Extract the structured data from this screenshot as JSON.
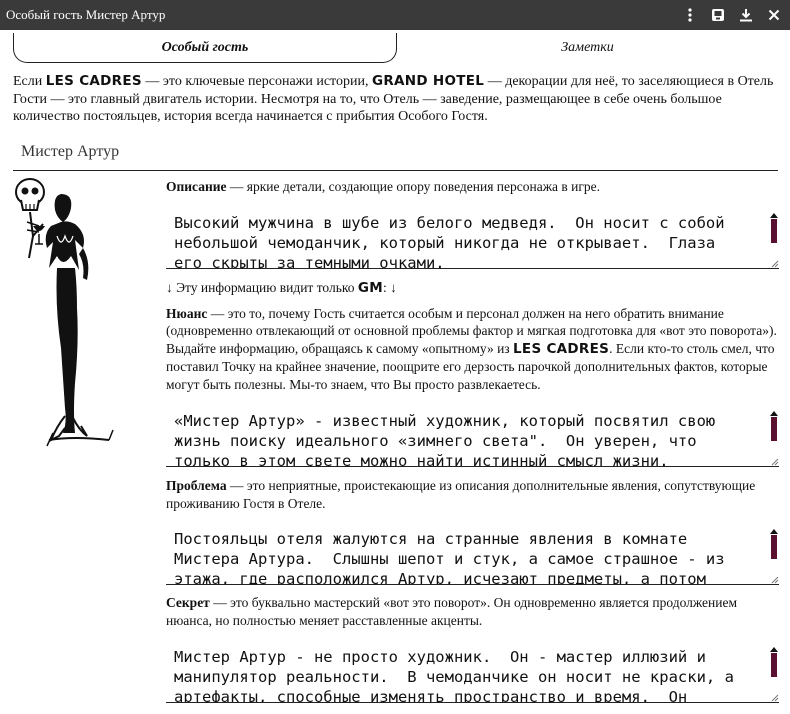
{
  "window": {
    "title": "Особый гость Мистер Артур",
    "menu_icon": "more-vert-icon",
    "save_icon": "save-icon",
    "download_icon": "download-icon",
    "close_icon": "close-icon"
  },
  "tabs": [
    {
      "label": "Особый гость"
    },
    {
      "label": "Заметки"
    }
  ],
  "intro": {
    "t1": "Если ",
    "les_cadres": "LES CADRES",
    "t2": " — это ключевые персонажи истории, ",
    "grand_hotel": "GRAND HOTEL",
    "t3": " — декорации для неё, то заселяющиеся в Отель Гости — это главный двигатель истории. Несмотря на то, что Отель — заведение, размещающее в себе очень большое количество постояльцев, история всегда начинается с прибытия Особого Гостя."
  },
  "guest_name": "Мистер Артур",
  "description": {
    "label": "Описание",
    "text": " — яркие детали, создающие опору поведения персонажа в игре.",
    "value": "Высокий мужчина в шубе из белого медведя.  Он носит с собой небольшой чемоданчик, который никогда не открывает.  Глаза его скрыты за темными очками."
  },
  "gm_note": {
    "t1": "↓ Эту информацию видит только ",
    "gm": "GM",
    "t2": ": ↓"
  },
  "nuance": {
    "label": "Нюанс",
    "t1": " — это то, почему Гость считается особым и персонал должен на него обратить внимание (одновременно отвлекающий от основной проблемы фактор и мягкая подготовка для «вот это поворота»). Выдайте информацию, обращаясь к самому «опытному» из ",
    "les_cadres": "LES CADRES",
    "t2": ". Если кто-то столь смел, что поставил Точку на крайнее значение, поощрите его дерзость парочкой дополнительных фактов, которые могут быть полезны. Мы-то знаем, что Вы просто развлекаетесь.",
    "value": "«Мистер Артур» - известный художник, который посвятил свою жизнь поиску идеального «зимнего света\".  Он уверен, что только в этом свете можно найти истинный смысл жизни."
  },
  "problem": {
    "label": "Проблема",
    "text": " — это неприятные, проистекающие из описания дополнительные явления, сопутствующие проживанию Гостя в Отеле.",
    "value": "Постояльцы отеля жалуются на странные явления в комнате Мистера Артура.  Слышны шепот и стук, а самое страшное - из этажа, где расположился Артур, исчезают предметы, а потом"
  },
  "secret": {
    "label": "Секрет",
    "text": " — это буквально мастерский «вот это поворот». Он одновременно является продолжением нюанса, но полностью меняет расставленные акценты.",
    "value": "Мистер Артур - не просто художник.  Он - мастер иллюзий и манипулятор реальности.  В чемоданчике он носит не краски, а артефакты, способные изменять пространство и время.  Он"
  },
  "colors": {
    "titlebar": "#3a3a3a",
    "scroll_thumb": "#5a1030"
  }
}
